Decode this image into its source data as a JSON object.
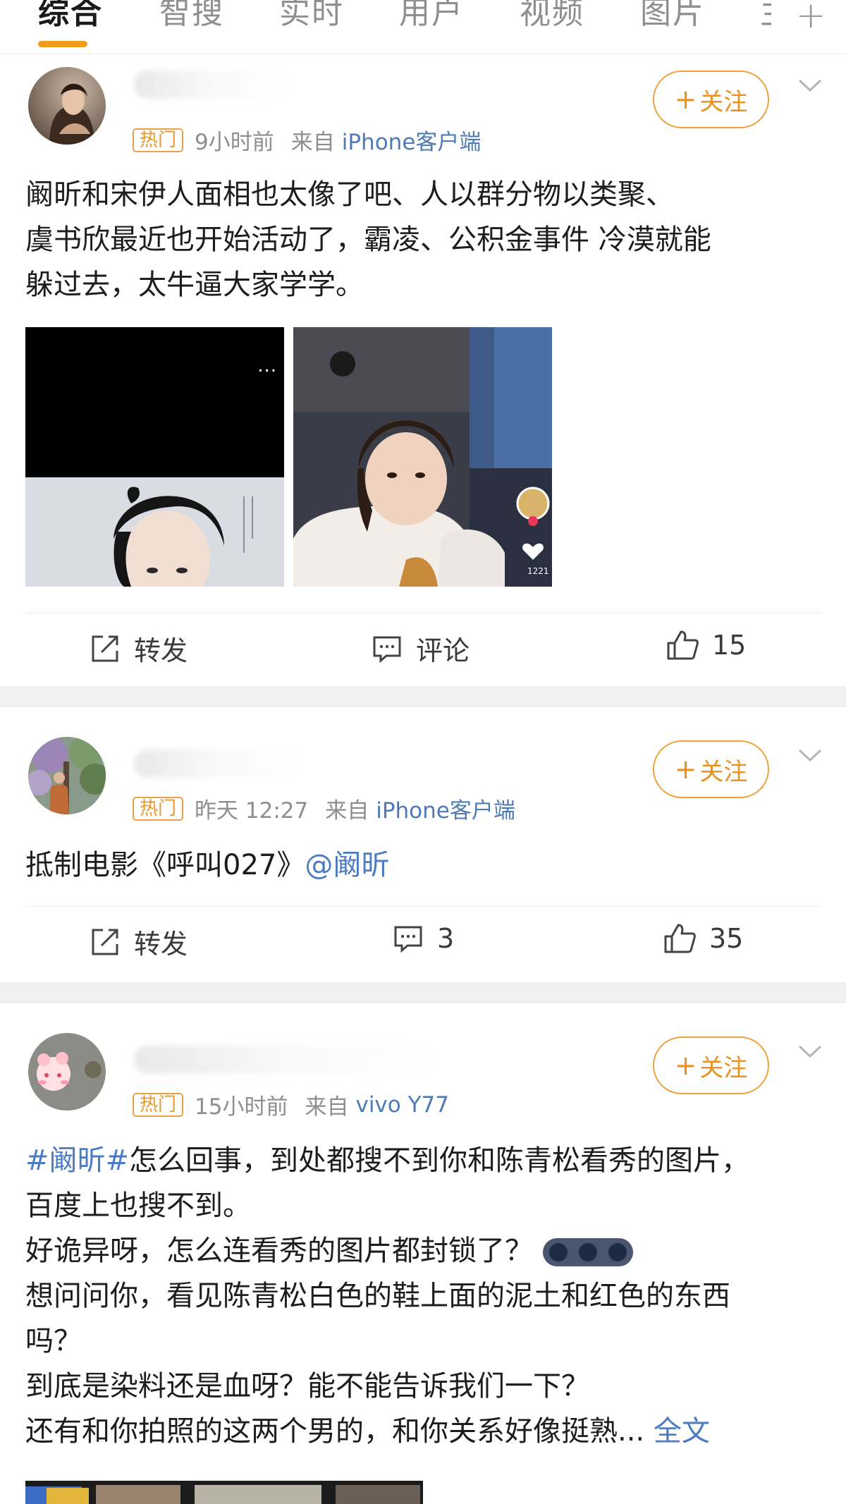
{
  "tabs": [
    {
      "label": "综合",
      "active": true
    },
    {
      "label": "智搜"
    },
    {
      "label": "实时"
    },
    {
      "label": "用户"
    },
    {
      "label": "视频"
    },
    {
      "label": "图片"
    },
    {
      "label": "主"
    }
  ],
  "follow_label": "关注",
  "posts": [
    {
      "badge": "热门",
      "time": "9小时前",
      "source_prefix": "来自",
      "source": "iPhone客户端",
      "lines": [
        "阚昕和宋伊人面相也太像了吧、人以群分物以类聚、",
        "虞书欣最近也开始活动了，霸凌、公积金事件  冷漠就能",
        "躲过去，太牛逼大家学学。"
      ],
      "image_badge": "...",
      "image2_count": "1221",
      "actions": {
        "repost": "转发",
        "comment": "评论",
        "like": "15"
      }
    },
    {
      "badge": "热门",
      "time": "昨天 12:27",
      "source_prefix": "来自",
      "source": "iPhone客户端",
      "text_plain": "抵制电影《呼叫027》",
      "text_mention": "@阚昕",
      "actions": {
        "repost": "转发",
        "comment": "3",
        "like": "35"
      }
    },
    {
      "badge": "热门",
      "time": "15小时前",
      "source_prefix": "来自",
      "source": "vivo Y77",
      "hashtag": "#阚昕#",
      "line1_rest": "怎么回事，到处都搜不到你和陈青松看秀的图片，",
      "lines": [
        "百度上也搜不到。",
        "好诡异呀，怎么连看秀的图片都封锁了？",
        "想问问你，看见陈青松白色的鞋上面的泥土和红色的东西",
        "吗？",
        "到底是染料还是血呀？能不能告诉我们一下？"
      ],
      "last_line": "还有和你拍照的这两个男的，和你关系好像挺熟...",
      "full_text": "全文"
    }
  ],
  "colors": {
    "accent": "#f39b1a",
    "link": "#4a7bc3",
    "badge": "#e8972a"
  }
}
